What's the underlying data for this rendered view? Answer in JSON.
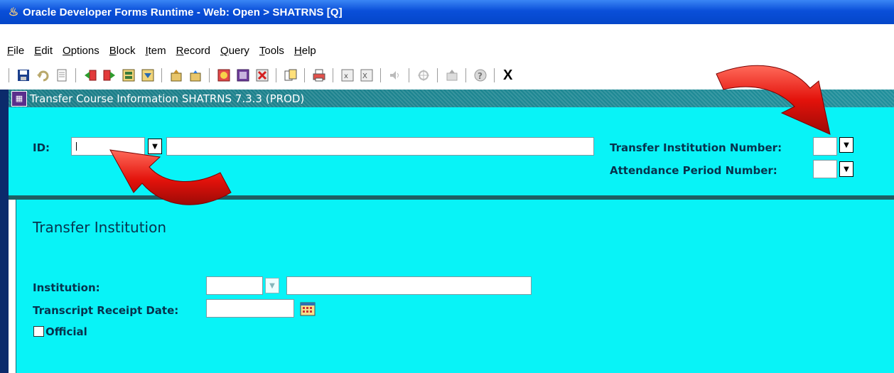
{
  "window": {
    "title": "Oracle Developer Forms Runtime - Web:  Open > SHATRNS [Q]",
    "icon": "java-cup-icon"
  },
  "menu": [
    {
      "mnemonic": "F",
      "rest": "ile"
    },
    {
      "mnemonic": "E",
      "rest": "dit"
    },
    {
      "mnemonic": "O",
      "rest": "ptions"
    },
    {
      "mnemonic": "B",
      "rest": "lock"
    },
    {
      "mnemonic": "I",
      "rest": "tem"
    },
    {
      "mnemonic": "R",
      "rest": "ecord"
    },
    {
      "mnemonic": "Q",
      "rest": "uery"
    },
    {
      "mnemonic": "T",
      "rest": "ools"
    },
    {
      "mnemonic": "H",
      "rest": "elp"
    }
  ],
  "toolbar": {
    "exit_label": "X"
  },
  "form": {
    "title": "Transfer Course Information  SHATRNS  7.3.3  (PROD)"
  },
  "key_block": {
    "id_label": "ID:",
    "id_value": "",
    "name_value": "",
    "institution_number_label": "Transfer Institution Number:",
    "institution_number_value": "",
    "attendance_period_label": "Attendance Period Number:",
    "attendance_period_value": ""
  },
  "section": {
    "title": "Transfer Institution",
    "institution_label": "Institution:",
    "institution_code": "",
    "institution_desc": "",
    "receipt_date_label": "Transcript Receipt Date:",
    "receipt_date_value": "",
    "official_label": "Official",
    "official_checked": false
  },
  "colors": {
    "canvas": "#08f3f7",
    "label": "#07324d",
    "arrow": "#e3120b"
  }
}
